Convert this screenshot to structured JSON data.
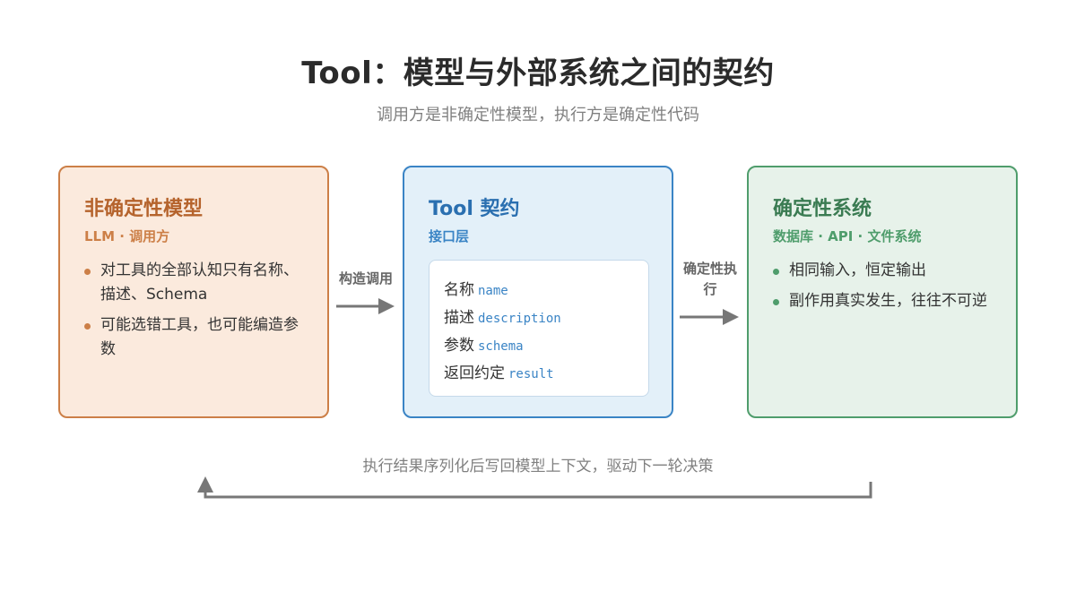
{
  "header": {
    "title": "Tool：模型与外部系统之间的契约",
    "subtitle": "调用方是非确定性模型，执行方是确定性代码"
  },
  "left_box": {
    "title": "非确定性模型",
    "subtitle": "LLM · 调用方",
    "bullets": [
      "对工具的全部认知只有名称、描述、Schema",
      "可能选错工具，也可能编造参数"
    ]
  },
  "middle_box": {
    "title": "Tool 契约",
    "subtitle": "接口层",
    "fields": [
      {
        "label": "名称",
        "code": "name"
      },
      {
        "label": "描述",
        "code": "description"
      },
      {
        "label": "参数",
        "code": "schema"
      },
      {
        "label": "返回约定",
        "code": "result"
      }
    ]
  },
  "right_box": {
    "title": "确定性系统",
    "subtitle": "数据库 · API · 文件系统",
    "bullets": [
      "相同输入，恒定输出",
      "副作用真实发生，往往不可逆"
    ]
  },
  "connectors": {
    "left_to_middle": "构造调用",
    "middle_to_right": "确定性执行"
  },
  "feedback": {
    "label": "执行结果序列化后写回模型上下文，驱动下一轮决策"
  },
  "colors": {
    "left_accent": "#cc7f47",
    "middle_accent": "#3a84c5",
    "right_accent": "#4f9d6c",
    "arrow": "#777777"
  }
}
